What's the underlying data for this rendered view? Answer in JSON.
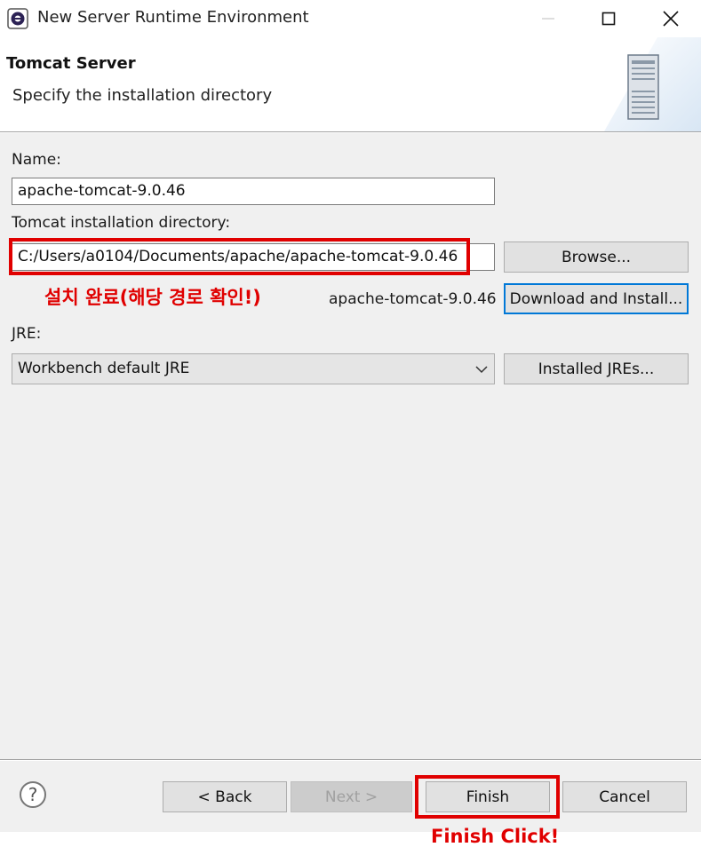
{
  "window": {
    "title": "New Server Runtime Environment",
    "controls": {
      "minimize": "—",
      "maximize": "☐",
      "close": "✕"
    }
  },
  "header": {
    "title": "Tomcat Server",
    "subtitle": "Specify the installation directory",
    "icon": "server-tower-icon"
  },
  "form": {
    "name_label": "Name:",
    "name_value": "apache-tomcat-9.0.46",
    "dir_label": "Tomcat installation directory:",
    "dir_value": "C:/Users/a0104/Documents/apache/apache-tomcat-9.0.46",
    "browse_label": "Browse...",
    "install_note": "설치 완료(해당 경로 확인!)",
    "installed_version": "apache-tomcat-9.0.46",
    "download_label": "Download and Install...",
    "jre_label": "JRE:",
    "jre_value": "Workbench default JRE",
    "installed_jres_label": "Installed JREs..."
  },
  "buttons": {
    "back": "< Back",
    "next": "Next >",
    "finish": "Finish",
    "cancel": "Cancel"
  },
  "annotations": {
    "finish_note": "Finish Click!"
  },
  "colors": {
    "annotation_red": "#e00000",
    "focus_blue": "#0078d7",
    "dialog_bg": "#f0f0f0"
  }
}
